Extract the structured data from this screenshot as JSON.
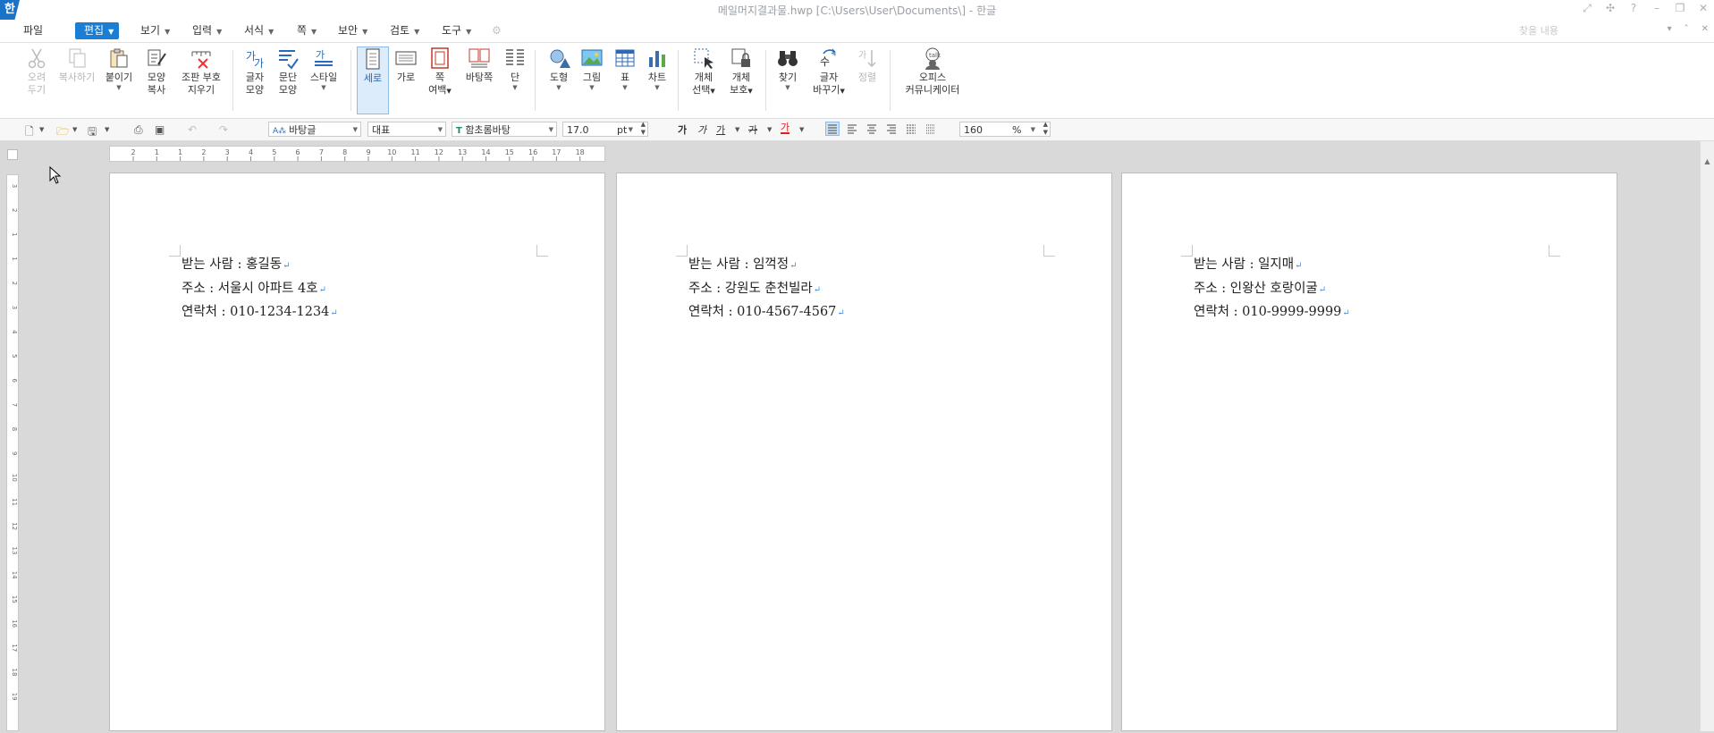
{
  "window": {
    "logo": "한",
    "title": "메일머지결과물.hwp [C:\\Users\\User\\Documents\\] - 한글",
    "controls": [
      "⤢",
      "✣",
      "?",
      "–",
      "❐",
      "✕"
    ]
  },
  "menu": {
    "items": [
      {
        "label": "파일",
        "dropdown": false
      },
      {
        "label": "편집",
        "dropdown": true,
        "active": true
      },
      {
        "label": "보기",
        "dropdown": true
      },
      {
        "label": "입력",
        "dropdown": true
      },
      {
        "label": "서식",
        "dropdown": true
      },
      {
        "label": "쪽",
        "dropdown": true
      },
      {
        "label": "보안",
        "dropdown": true
      },
      {
        "label": "검토",
        "dropdown": true
      },
      {
        "label": "도구",
        "dropdown": true
      }
    ],
    "search_placeholder": "찾을 내용",
    "right_controls": [
      "▾",
      "˄",
      "✕"
    ]
  },
  "ribbon": {
    "cut": {
      "l1": "오려",
      "l2": "두기"
    },
    "copy": {
      "l1": "복사하기"
    },
    "paste": {
      "l1": "붙이기"
    },
    "format_copy": {
      "l1": "모양",
      "l2": "복사"
    },
    "clear_format": {
      "l1": "조판 부호",
      "l2": "지우기"
    },
    "char_shape": {
      "l1": "글자",
      "l2": "모양"
    },
    "para_shape": {
      "l1": "문단",
      "l2": "모양"
    },
    "style": {
      "l1": "스타일"
    },
    "portrait": {
      "l1": "세로"
    },
    "landscape": {
      "l1": "가로"
    },
    "margin": {
      "l1": "쪽",
      "l2": "여백"
    },
    "background": {
      "l1": "바탕쪽"
    },
    "columns": {
      "l1": "단"
    },
    "shape": {
      "l1": "도형"
    },
    "picture": {
      "l1": "그림"
    },
    "table": {
      "l1": "표"
    },
    "chart": {
      "l1": "차트"
    },
    "obj_select": {
      "l1": "개체",
      "l2": "선택"
    },
    "obj_protect": {
      "l1": "개체",
      "l2": "보호"
    },
    "find": {
      "l1": "찾기"
    },
    "replace": {
      "l1": "글자",
      "l2": "바꾸기"
    },
    "sort": {
      "l1": "정렬"
    },
    "office": {
      "l1": "오피스",
      "l2": "커뮤니케이터"
    }
  },
  "toolbar": {
    "style_name": "바탕글",
    "lang": "대표",
    "font": "함초롬바탕",
    "font_size": "17.0",
    "size_unit": "pt",
    "bold": "가",
    "italic": "가",
    "underline": "가",
    "strike": "가",
    "font_color": "가",
    "zoom": "160",
    "zoom_unit": "%"
  },
  "ruler": {
    "h_ticks": [
      "2",
      "1",
      "1",
      "2",
      "3",
      "4",
      "5",
      "6",
      "7",
      "8",
      "9",
      "10",
      "11",
      "12",
      "13",
      "14",
      "15",
      "16",
      "17",
      "18"
    ],
    "v_ticks": [
      "3",
      "2",
      "1",
      "1",
      "2",
      "3",
      "4",
      "5",
      "6",
      "7",
      "8",
      "9",
      "10",
      "11",
      "12",
      "13",
      "14",
      "15",
      "16",
      "17",
      "18",
      "19"
    ]
  },
  "pages": [
    {
      "lines": [
        "받는 사람 : 홍길동",
        "주소 : 서울시 아파트 4호",
        "연락처 : 010-1234-1234"
      ]
    },
    {
      "lines": [
        "받는 사람 : 임꺽정",
        "주소 : 강원도 춘천빌라",
        "연락처 : 010-4567-4567"
      ]
    },
    {
      "lines": [
        "받는 사람 : 일지매",
        "주소 : 인왕산 호랑이굴",
        "연락처 : 010-9999-9999"
      ]
    }
  ],
  "para_mark": "↵",
  "colors": {
    "accent": "#1a7fd4",
    "logo": "#1a73c9"
  }
}
